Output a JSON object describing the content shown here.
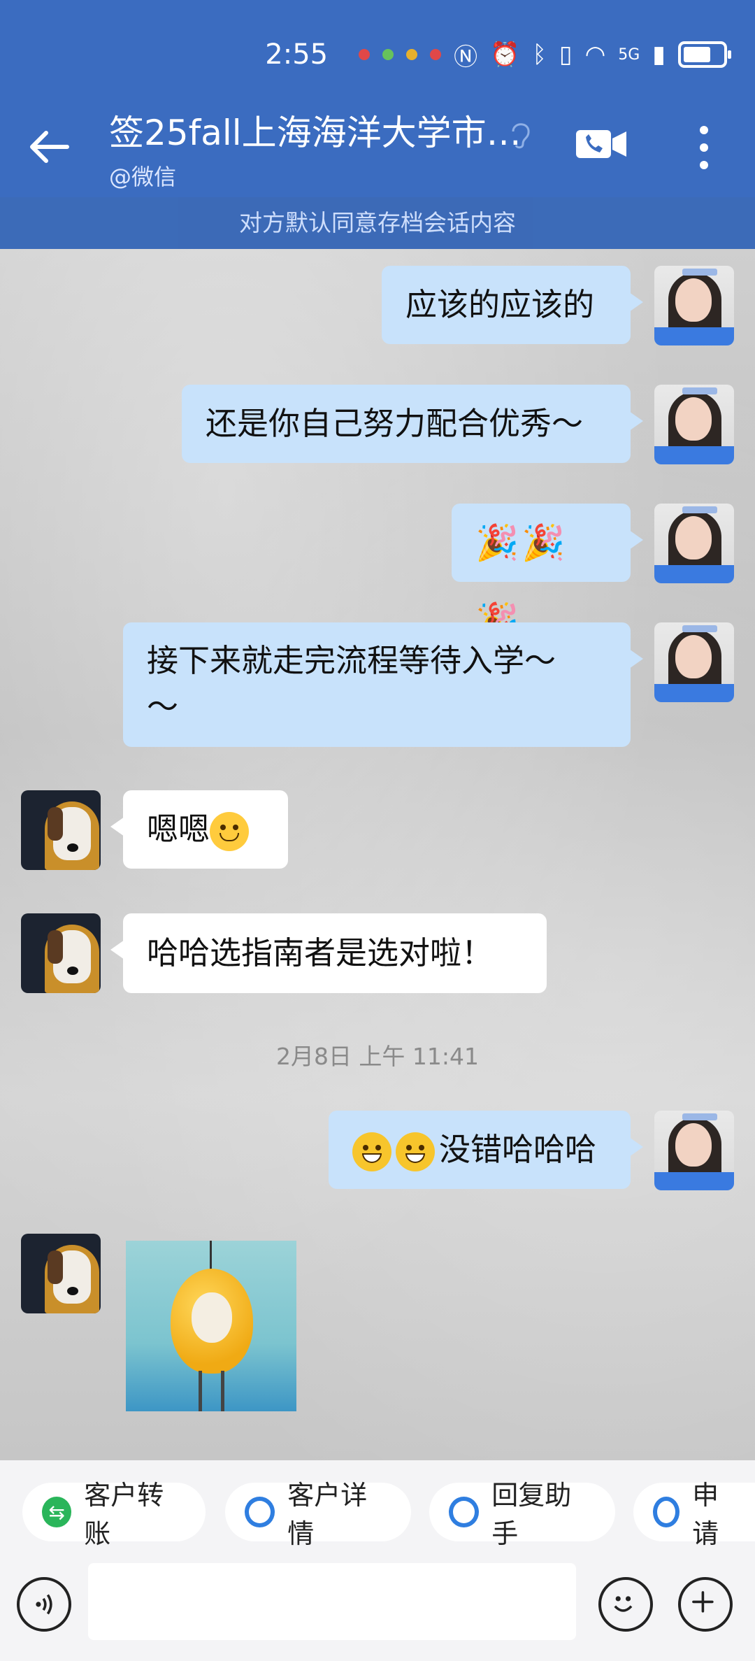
{
  "status_bar": {
    "time": "2:55",
    "network": "5G"
  },
  "header": {
    "title": "签25fall上海海洋大学市…",
    "subtitle": "@微信",
    "notice": "对方默认同意存档会话内容"
  },
  "messages": [
    {
      "from": "me",
      "text": "应该的应该的"
    },
    {
      "from": "me",
      "text": "还是你自己努力配合优秀～"
    },
    {
      "from": "me",
      "text": "🎉🎉🎉"
    },
    {
      "from": "me",
      "line1": "接下来就走完流程等待入学～",
      "line2": "～"
    },
    {
      "from": "them",
      "text": "嗯嗯"
    },
    {
      "from": "them",
      "text": "哈哈选指南者是选对啦！"
    },
    {
      "from": "me",
      "text": "没错哈哈哈"
    }
  ],
  "timestamp": "2月8日  上午 11:41",
  "quick_actions": [
    {
      "label": "客户转账",
      "icon": "transfer-icon"
    },
    {
      "label": "客户详情",
      "icon": "customer-detail-icon"
    },
    {
      "label": "回复助手",
      "icon": "reply-assistant-icon"
    },
    {
      "label": "申请",
      "icon": "apply-icon"
    }
  ],
  "input": {
    "placeholder": ""
  },
  "colors": {
    "header": "#3b6cc0",
    "bubble_me": "#c8e2fb",
    "bubble_them": "#ffffff",
    "accent": "#2f7ee0"
  }
}
